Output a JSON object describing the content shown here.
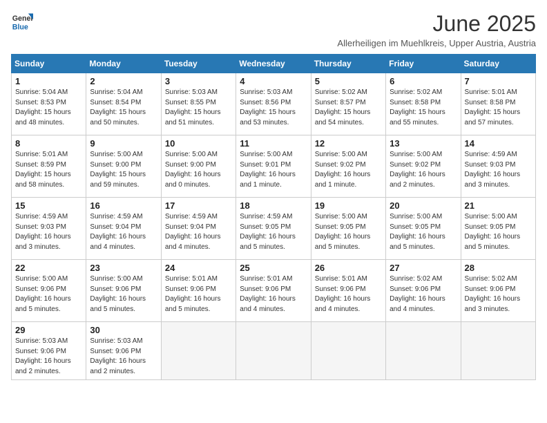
{
  "logo": {
    "line1": "General",
    "line2": "Blue"
  },
  "title": "June 2025",
  "subtitle": "Allerheiligen im Muehlkreis, Upper Austria, Austria",
  "days_of_week": [
    "Sunday",
    "Monday",
    "Tuesday",
    "Wednesday",
    "Thursday",
    "Friday",
    "Saturday"
  ],
  "weeks": [
    [
      {
        "day": "1",
        "info": "Sunrise: 5:04 AM\nSunset: 8:53 PM\nDaylight: 15 hours\nand 48 minutes."
      },
      {
        "day": "2",
        "info": "Sunrise: 5:04 AM\nSunset: 8:54 PM\nDaylight: 15 hours\nand 50 minutes."
      },
      {
        "day": "3",
        "info": "Sunrise: 5:03 AM\nSunset: 8:55 PM\nDaylight: 15 hours\nand 51 minutes."
      },
      {
        "day": "4",
        "info": "Sunrise: 5:03 AM\nSunset: 8:56 PM\nDaylight: 15 hours\nand 53 minutes."
      },
      {
        "day": "5",
        "info": "Sunrise: 5:02 AM\nSunset: 8:57 PM\nDaylight: 15 hours\nand 54 minutes."
      },
      {
        "day": "6",
        "info": "Sunrise: 5:02 AM\nSunset: 8:58 PM\nDaylight: 15 hours\nand 55 minutes."
      },
      {
        "day": "7",
        "info": "Sunrise: 5:01 AM\nSunset: 8:58 PM\nDaylight: 15 hours\nand 57 minutes."
      }
    ],
    [
      {
        "day": "8",
        "info": "Sunrise: 5:01 AM\nSunset: 8:59 PM\nDaylight: 15 hours\nand 58 minutes."
      },
      {
        "day": "9",
        "info": "Sunrise: 5:00 AM\nSunset: 9:00 PM\nDaylight: 15 hours\nand 59 minutes."
      },
      {
        "day": "10",
        "info": "Sunrise: 5:00 AM\nSunset: 9:00 PM\nDaylight: 16 hours\nand 0 minutes."
      },
      {
        "day": "11",
        "info": "Sunrise: 5:00 AM\nSunset: 9:01 PM\nDaylight: 16 hours\nand 1 minute."
      },
      {
        "day": "12",
        "info": "Sunrise: 5:00 AM\nSunset: 9:02 PM\nDaylight: 16 hours\nand 1 minute."
      },
      {
        "day": "13",
        "info": "Sunrise: 5:00 AM\nSunset: 9:02 PM\nDaylight: 16 hours\nand 2 minutes."
      },
      {
        "day": "14",
        "info": "Sunrise: 4:59 AM\nSunset: 9:03 PM\nDaylight: 16 hours\nand 3 minutes."
      }
    ],
    [
      {
        "day": "15",
        "info": "Sunrise: 4:59 AM\nSunset: 9:03 PM\nDaylight: 16 hours\nand 3 minutes."
      },
      {
        "day": "16",
        "info": "Sunrise: 4:59 AM\nSunset: 9:04 PM\nDaylight: 16 hours\nand 4 minutes."
      },
      {
        "day": "17",
        "info": "Sunrise: 4:59 AM\nSunset: 9:04 PM\nDaylight: 16 hours\nand 4 minutes."
      },
      {
        "day": "18",
        "info": "Sunrise: 4:59 AM\nSunset: 9:05 PM\nDaylight: 16 hours\nand 5 minutes."
      },
      {
        "day": "19",
        "info": "Sunrise: 5:00 AM\nSunset: 9:05 PM\nDaylight: 16 hours\nand 5 minutes."
      },
      {
        "day": "20",
        "info": "Sunrise: 5:00 AM\nSunset: 9:05 PM\nDaylight: 16 hours\nand 5 minutes."
      },
      {
        "day": "21",
        "info": "Sunrise: 5:00 AM\nSunset: 9:05 PM\nDaylight: 16 hours\nand 5 minutes."
      }
    ],
    [
      {
        "day": "22",
        "info": "Sunrise: 5:00 AM\nSunset: 9:06 PM\nDaylight: 16 hours\nand 5 minutes."
      },
      {
        "day": "23",
        "info": "Sunrise: 5:00 AM\nSunset: 9:06 PM\nDaylight: 16 hours\nand 5 minutes."
      },
      {
        "day": "24",
        "info": "Sunrise: 5:01 AM\nSunset: 9:06 PM\nDaylight: 16 hours\nand 5 minutes."
      },
      {
        "day": "25",
        "info": "Sunrise: 5:01 AM\nSunset: 9:06 PM\nDaylight: 16 hours\nand 4 minutes."
      },
      {
        "day": "26",
        "info": "Sunrise: 5:01 AM\nSunset: 9:06 PM\nDaylight: 16 hours\nand 4 minutes."
      },
      {
        "day": "27",
        "info": "Sunrise: 5:02 AM\nSunset: 9:06 PM\nDaylight: 16 hours\nand 4 minutes."
      },
      {
        "day": "28",
        "info": "Sunrise: 5:02 AM\nSunset: 9:06 PM\nDaylight: 16 hours\nand 3 minutes."
      }
    ],
    [
      {
        "day": "29",
        "info": "Sunrise: 5:03 AM\nSunset: 9:06 PM\nDaylight: 16 hours\nand 2 minutes."
      },
      {
        "day": "30",
        "info": "Sunrise: 5:03 AM\nSunset: 9:06 PM\nDaylight: 16 hours\nand 2 minutes."
      },
      {
        "day": "",
        "info": ""
      },
      {
        "day": "",
        "info": ""
      },
      {
        "day": "",
        "info": ""
      },
      {
        "day": "",
        "info": ""
      },
      {
        "day": "",
        "info": ""
      }
    ]
  ]
}
